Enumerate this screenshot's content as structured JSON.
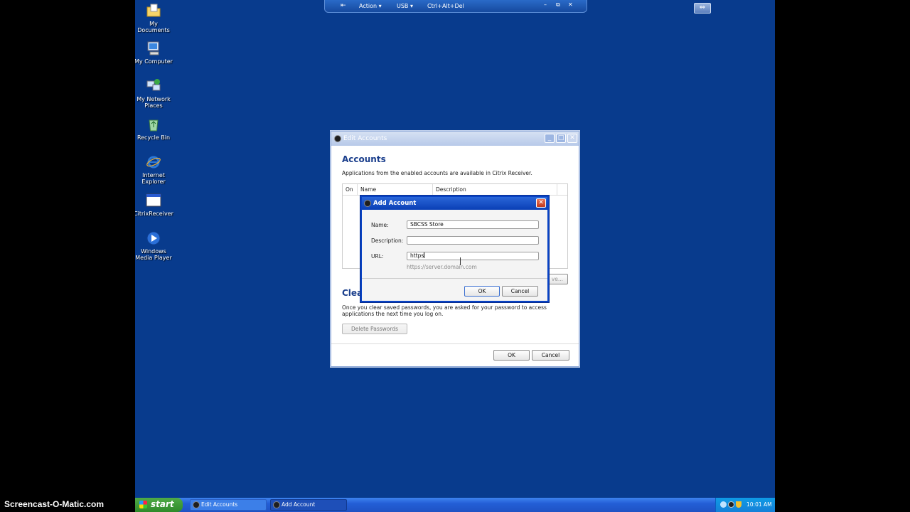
{
  "watermark": "Screencast-O-Matic.com",
  "desktop_icons": [
    {
      "label": "My Documents",
      "icon": "folder-icon"
    },
    {
      "label": "My Computer",
      "icon": "computer-icon"
    },
    {
      "label": "My Network Places",
      "icon": "network-icon"
    },
    {
      "label": "Recycle Bin",
      "icon": "recycle-bin-icon"
    },
    {
      "label": "Internet Explorer",
      "icon": "internet-explorer-icon"
    },
    {
      "label": "CitrixReceiver",
      "icon": "citrix-receiver-icon"
    },
    {
      "label": "Windows Media Player",
      "icon": "media-player-icon"
    }
  ],
  "remote_toolbar": {
    "action": "Action",
    "usb": "USB",
    "cad": "Ctrl+Alt+Del"
  },
  "edit_accounts": {
    "title": "Edit Accounts",
    "accounts_heading": "Accounts",
    "accounts_desc": "Applications from the enabled accounts are available in Citrix Receiver.",
    "columns": [
      "On",
      "Name",
      "Description"
    ],
    "remove_label": "ve...",
    "clear_heading": "Clea",
    "clear_desc": "Once you clear saved passwords, you are asked for your password to access applications the next time you log on.",
    "delete_passwords": "Delete Passwords",
    "ok": "OK",
    "cancel": "Cancel"
  },
  "add_account": {
    "title": "Add Account",
    "name_label": "Name:",
    "name_value": "SBCSS Store",
    "description_label": "Description:",
    "description_value": "",
    "url_label": "URL:",
    "url_value": "https",
    "url_hint": "https://server.domain.com",
    "ok": "OK",
    "cancel": "Cancel"
  },
  "taskbar": {
    "start": "start",
    "tasks": [
      "Edit Accounts",
      "Add Account"
    ],
    "clock": "10:01 AM"
  }
}
